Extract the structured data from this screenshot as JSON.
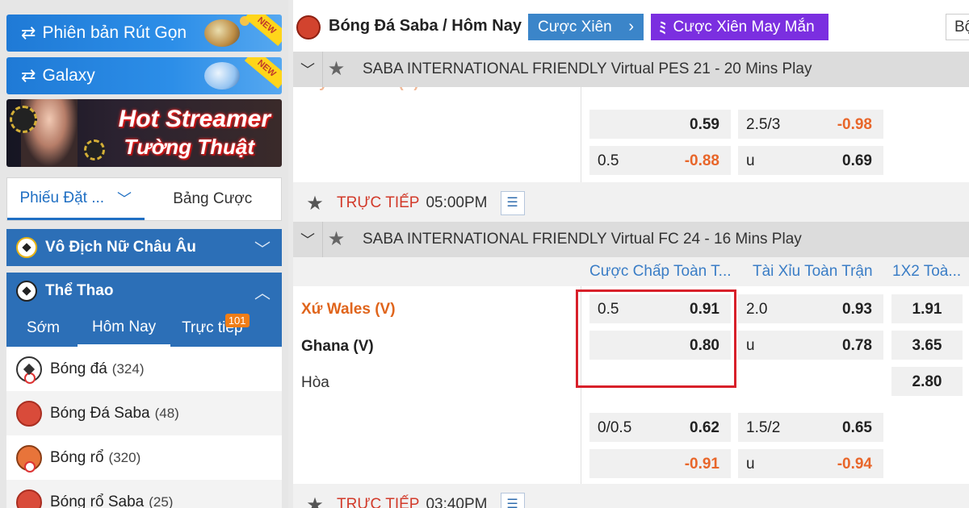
{
  "sidebar": {
    "promo1": {
      "label": "Phiên bản Rút Gọn",
      "badge": "NEW"
    },
    "promo2": {
      "label": "Galaxy",
      "badge": "NEW"
    },
    "banner": {
      "line1": "Hot Streamer",
      "line2": "Tường Thuật"
    },
    "slip_tabs": [
      {
        "label": "Phiếu Đặt ..."
      },
      {
        "label": "Bảng Cược"
      }
    ],
    "sections": [
      {
        "label": "Vô Địch Nữ Châu Âu",
        "caret": "﹀"
      },
      {
        "label": "Thể Thao",
        "caret": "︿"
      }
    ],
    "time_tabs": [
      {
        "label": "Sớm"
      },
      {
        "label": "Hôm Nay"
      },
      {
        "label": "Trực tiếp",
        "badge": "101"
      }
    ],
    "sports": [
      {
        "label": "Bóng đá",
        "count": "(324)"
      },
      {
        "label": "Bóng Đá Saba",
        "count": "(48)"
      },
      {
        "label": "Bóng rổ",
        "count": "(320)"
      },
      {
        "label": "Bóng rổ Saba",
        "count": "(25)"
      }
    ]
  },
  "header": {
    "title": "Bóng Đá Saba / Hôm Nay",
    "parlay_label": "Cược Xiên",
    "lucky_label": "Cược Xiên May Mắn",
    "filter_label": "Bộ"
  },
  "leagues": [
    {
      "name": "SABA INTERNATIONAL FRIENDLY Virtual PES 21 - 20 Mins Play"
    },
    {
      "name": "SABA INTERNATIONAL FRIENDLY Virtual FC 24 - 16 Mins Play"
    }
  ],
  "partial_team": "Tây Ban Nha (V)",
  "block1": {
    "row1": {
      "hdp_odds": "0.59",
      "ou_line": "2.5/3",
      "ou_odds": "-0.98"
    },
    "row2": {
      "hdp_line": "0.5",
      "hdp_odds": "-0.88",
      "ou_line": "u",
      "ou_odds": "0.69"
    }
  },
  "live_rows": [
    {
      "tag": "TRỰC TIẾP",
      "time": "05:00PM"
    },
    {
      "tag": "TRỰC TIẾP",
      "time": "03:40PM"
    }
  ],
  "columns": [
    "Cược Chấp Toàn T...",
    "Tài Xỉu Toàn Trận",
    "1X2 Toà..."
  ],
  "match": {
    "home": "Xứ Wales (V)",
    "away": "Ghana (V)",
    "draw": "Hòa",
    "main": {
      "hdp": [
        {
          "line": "0.5",
          "odds": "0.91"
        },
        {
          "line": "",
          "odds": "0.80"
        }
      ],
      "ou": [
        {
          "line": "2.0",
          "odds": "0.93"
        },
        {
          "line": "u",
          "odds": "0.78"
        }
      ],
      "x12": [
        "1.91",
        "3.65",
        "2.80"
      ]
    },
    "alt": {
      "hdp": [
        {
          "line": "0/0.5",
          "odds": "0.62"
        },
        {
          "line": "",
          "odds": "-0.91"
        }
      ],
      "ou": [
        {
          "line": "1.5/2",
          "odds": "0.65"
        },
        {
          "line": "u",
          "odds": "-0.94"
        }
      ]
    }
  },
  "colors": {
    "accent": "#2c6fb7",
    "live": "#d23a2a",
    "home_team": "#e0651c",
    "negative_odds": "#e8662a",
    "highlight": "#d8202a",
    "lucky": "#7b2fe0"
  }
}
